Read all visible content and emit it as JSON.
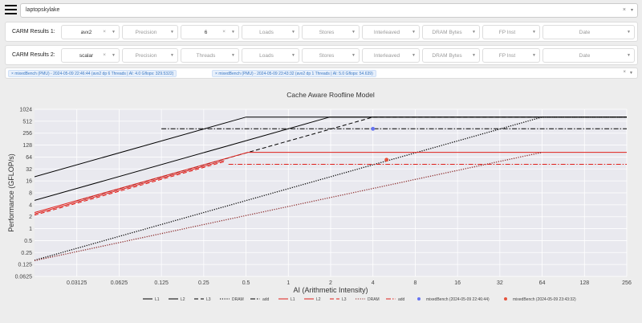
{
  "top": {
    "machine": "laptopskylake",
    "clear": "×",
    "arrow": "▾"
  },
  "panel1": {
    "label": "CARM Results 1:",
    "isa": "avx2",
    "precision": "Precision",
    "threads": "6",
    "loads": "Loads",
    "stores": "Stores",
    "interleaved": "Interleaved",
    "dram_bytes": "DRAM Bytes",
    "fp_inst": "FP Inst",
    "date": "Date"
  },
  "panel2": {
    "label": "CARM Results 2:",
    "isa": "scalar",
    "precision": "Precision",
    "threads": "Threads",
    "loads": "Loads",
    "stores": "Stores",
    "interleaved": "Interleaved",
    "dram_bytes": "DRAM Bytes",
    "fp_inst": "FP Inst",
    "date": "Date"
  },
  "tags": [
    "mixedBench (PMU) - 2024-05-09 22:46:44 (avx2 dp 6 Threads | AI: 4.0 Gflops: 329.5322)",
    "mixedBench (PMU) - 2024-05-09 23:43:32 (avx2 dp 1 Threads | AI: 5.0 Gflops: 54.639)"
  ],
  "chart_data": {
    "type": "line",
    "title": "Cache Aware Roofline Model",
    "xlabel": "AI (Arithmetic Intensity)",
    "ylabel": "Performance (GFLOP/s)",
    "x_scale": "log2",
    "y_scale": "log2",
    "xlim": [
      0.015625,
      256
    ],
    "ylim": [
      0.0625,
      1024
    ],
    "x_ticks": [
      "0.03125",
      "0.0625",
      "0.125",
      "0.25",
      "0.5",
      "1",
      "2",
      "4",
      "8",
      "16",
      "32",
      "64",
      "128",
      "256"
    ],
    "y_ticks": [
      "0.0625",
      "0.125",
      "0.25",
      "0.5",
      "1",
      "2",
      "4",
      "8",
      "16",
      "32",
      "64",
      "128",
      "256",
      "512",
      "1024"
    ],
    "colors": {
      "result1": "#000000",
      "result2": "#e0201b",
      "point1": "#6674f3",
      "point2": "#e5533c",
      "dram2": "#8b2a2a"
    },
    "series": [
      {
        "name": "L1",
        "group": 1,
        "style": "solid",
        "bw": 1300,
        "peak": 650,
        "x": [
          0.015625,
          0.5,
          256
        ]
      },
      {
        "name": "L2",
        "group": 1,
        "style": "solid",
        "bw": 330,
        "peak": 650,
        "x": [
          0.015625,
          1.97,
          256
        ]
      },
      {
        "name": "L3",
        "group": 1,
        "style": "dashed",
        "bw": 162,
        "peak": 650,
        "x": [
          0.03125,
          4.0,
          256
        ]
      },
      {
        "name": "DRAM",
        "group": 1,
        "style": "dotted",
        "bw": 10.2,
        "peak": 650,
        "x": [
          0.015625,
          64,
          256
        ]
      },
      {
        "name": "add",
        "group": 1,
        "style": "dashdot",
        "bw": 0,
        "peak": 329.5,
        "x": [
          0.125,
          256
        ]
      },
      {
        "name": "L1",
        "group": 2,
        "style": "solid",
        "bw": 163,
        "peak": 84,
        "x": [
          0.015625,
          0.515,
          256
        ]
      },
      {
        "name": "L2",
        "group": 2,
        "style": "solid",
        "bw": 150,
        "peak": 84,
        "x": [
          0.015625,
          0.35
        ]
      },
      {
        "name": "L3",
        "group": 2,
        "style": "dashed",
        "bw": 140,
        "peak": 84,
        "x": [
          0.015625,
          0.35
        ]
      },
      {
        "name": "DRAM",
        "group": 2,
        "style": "dotted",
        "bw": 10.0,
        "peak": 84,
        "x": [
          0.015625,
          64
        ]
      },
      {
        "name": "add",
        "group": 2,
        "style": "dashdot",
        "bw": 0,
        "peak": 42,
        "x": [
          0.375,
          256
        ]
      }
    ],
    "points": [
      {
        "name": "mixedBench (2024-05-09 22:46:44)",
        "x": 4.0,
        "y": 329.5322
      },
      {
        "name": "mixedBench (2024-05-09 23:43:32)",
        "x": 5.0,
        "y": 54.639
      }
    ],
    "legend": [
      "L1",
      "L2",
      "L3",
      "DRAM",
      "add",
      "L1",
      "L2",
      "L3",
      "DRAM",
      "add",
      "mixedBench (2024-05-09 22:46:44)",
      "mixedBench (2024-05-09 23:43:32)"
    ],
    "legend_position": "bottom"
  }
}
